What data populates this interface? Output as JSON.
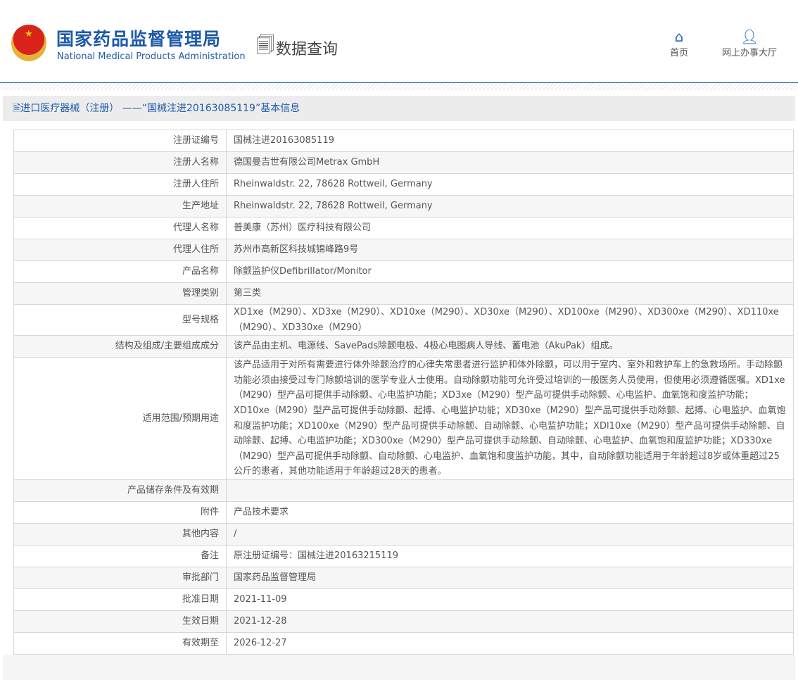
{
  "header": {
    "title_cn": "国家药品监督管理局",
    "title_en": "National Medical Products Administration",
    "query_label": "数据查询",
    "nav": [
      {
        "label": "首页",
        "icon": "home-icon"
      },
      {
        "label": "网上办事大厅",
        "icon": "user-icon"
      }
    ]
  },
  "section_title": "进口医疗器械（注册） ——“国械注进20163085119”基本信息",
  "rows": [
    {
      "label": "注册证编号",
      "value": "国械注进20163085119"
    },
    {
      "label": "注册人名称",
      "value": "德国曼吉世有限公司Metrax GmbH"
    },
    {
      "label": "注册人住所",
      "value": "Rheinwaldstr. 22, 78628 Rottweil, Germany"
    },
    {
      "label": "生产地址",
      "value": "Rheinwaldstr. 22, 78628 Rottweil, Germany"
    },
    {
      "label": "代理人名称",
      "value": "普美康（苏州）医疗科技有限公司"
    },
    {
      "label": "代理人住所",
      "value": "苏州市高新区科技城锦峰路9号"
    },
    {
      "label": "产品名称",
      "value": "除颤监护仪Defibrillator/Monitor"
    },
    {
      "label": "管理类别",
      "value": "第三类"
    },
    {
      "label": "型号规格",
      "value": "XD1xe（M290）、XD3xe（M290）、XD10xe（M290）、XD30xe（M290）、XD100xe（M290）、XD300xe（M290）、XD110xe（M290）、XD330xe（M290）"
    },
    {
      "label": "结构及组成/主要组成成分",
      "value": "该产品由主机、电源线、SavePads除颤电极、4极心电图病人导线、蓄电池（AkuPak）组成。"
    },
    {
      "label": "适用范围/预期用途",
      "value": "该产品适用于对所有需要进行体外除颤治疗的心律失常患者进行监护和体外除颤，可以用于室内、室外和救护车上的急救场所。手动除颤功能必须由接受过专门除颤培训的医学专业人士使用。自动除颤功能可允许受过培训的一般医务人员使用，但使用必须遵循医嘱。XD1xe（M290）型产品可提供手动除颤、心电监护功能；XD3xe（M290）型产品可提供手动除颤、心电监护、血氧饱和度监护功能；XD10xe（M290）型产品可提供手动除颤、起搏、心电监护功能；XD30xe（M290）型产品可提供手动除颤、起搏、心电监护、血氧饱和度监护功能；XD100xe（M290）型产品可提供手动除颤、自动除颤、心电监护功能；XDl10xe（M290）型产品可提供手动除颤、自动除颤、起搏、心电监护功能；XD300xe（M290）型产品可提供手动除颤、自动除颤、心电监护、血氧饱和度监护功能；XD330xe（M290）型产品可提供手动除颤、自动除颤、心电监护、血氧饱和度监护功能，其中，自动除颤功能适用于年龄超过8岁或体重超过25公斤的患者，其他功能适用于年龄超过28天的患者。"
    },
    {
      "label": "产品储存条件及有效期",
      "value": ""
    },
    {
      "label": "附件",
      "value": "产品技术要求"
    },
    {
      "label": "其他内容",
      "value": "/"
    },
    {
      "label": "备注",
      "value": "原注册证编号：国械注进20163215119"
    },
    {
      "label": "审批部门",
      "value": "国家药品监督管理局"
    },
    {
      "label": "批准日期",
      "value": "2021-11-09"
    },
    {
      "label": "生效日期",
      "value": "2021-12-28"
    },
    {
      "label": "有效期至",
      "value": "2026-12-27"
    }
  ]
}
